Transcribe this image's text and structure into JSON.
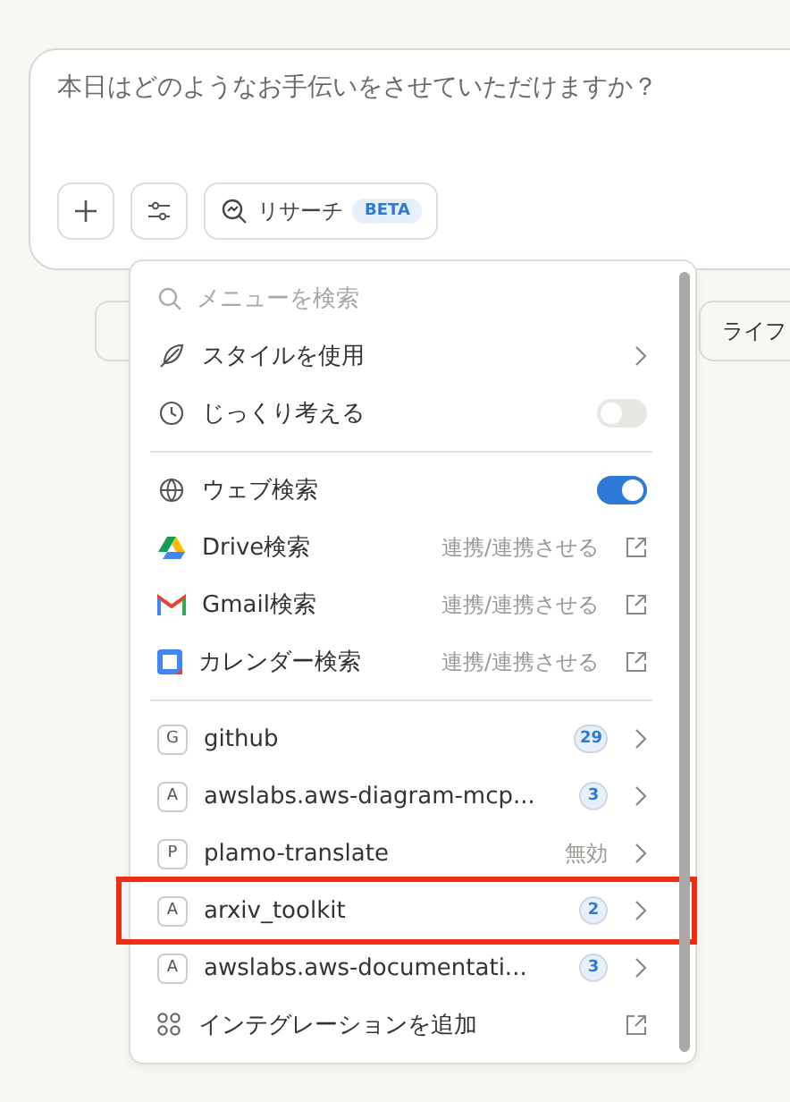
{
  "composer": {
    "placeholder": "本日はどのようなお手伝いをさせていただけますか？",
    "research": {
      "label": "リサーチ",
      "badge": "BETA"
    }
  },
  "background_chips": [
    {
      "label": "ライフ"
    }
  ],
  "menu": {
    "search": {
      "placeholder": "メニューを検索"
    },
    "sections": [
      {
        "items": [
          {
            "kind": "submenu",
            "label": "スタイルを使用"
          },
          {
            "kind": "toggle",
            "label": "じっくり考える",
            "on": false
          }
        ]
      },
      {
        "items": [
          {
            "kind": "toggle",
            "label": "ウェブ検索",
            "on": true
          },
          {
            "kind": "link",
            "label": "Drive検索",
            "status": "連携/連携させる"
          },
          {
            "kind": "link",
            "label": "Gmail検索",
            "status": "連携/連携させる"
          },
          {
            "kind": "link",
            "label": "カレンダー検索",
            "status": "連携/連携させる"
          }
        ]
      },
      {
        "items": [
          {
            "kind": "integration",
            "letter": "G",
            "label": "github",
            "count": "29",
            "highlighted": false
          },
          {
            "kind": "integration",
            "letter": "A",
            "label": "awslabs.aws-diagram-mcp...",
            "count": "3",
            "highlighted": false
          },
          {
            "kind": "integration",
            "letter": "P",
            "label": "plamo-translate",
            "status": "無効",
            "highlighted": false
          },
          {
            "kind": "integration",
            "letter": "A",
            "label": "arxiv_toolkit",
            "count": "2",
            "highlighted": true
          },
          {
            "kind": "integration",
            "letter": "A",
            "label": "awslabs.aws-documentati...",
            "count": "3",
            "highlighted": false
          },
          {
            "kind": "add",
            "label": "インテグレーションを追加"
          }
        ]
      }
    ]
  }
}
